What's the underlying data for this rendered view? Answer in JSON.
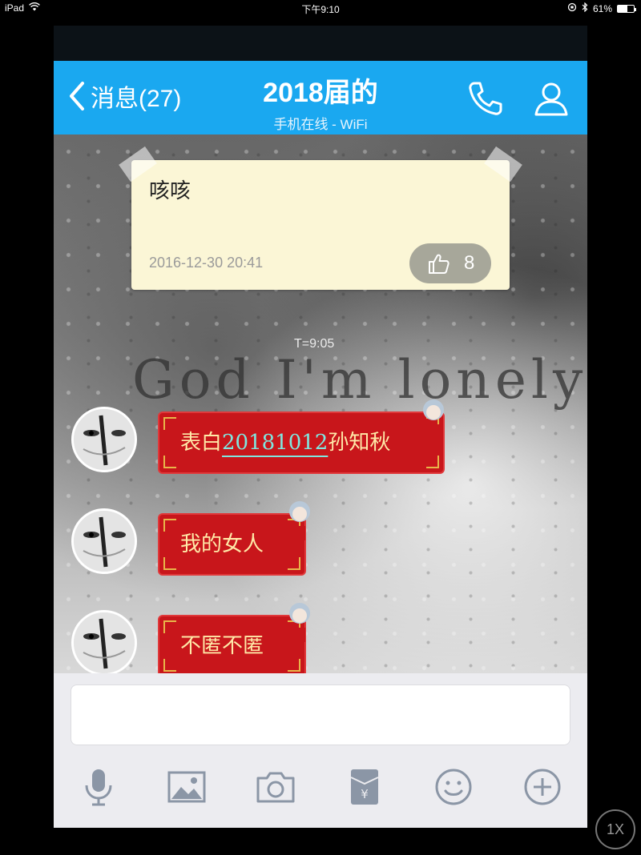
{
  "status_bar": {
    "device": "iPad",
    "time": "下午9:10",
    "battery": "61%",
    "battery_level": 0.61
  },
  "nav": {
    "back_label": "消息(27)",
    "title": "2018届的",
    "subtitle": "手机在线 - WiFi"
  },
  "pinned_note": {
    "text": "咳咳",
    "date": "2016-12-30 20:41",
    "likes": "8"
  },
  "background": {
    "overlay_text": "God I'm lonely",
    "time_mark": "T=9:05"
  },
  "messages": [
    {
      "prefix": "表白",
      "highlight": "20181012",
      "suffix": "孙知秋"
    },
    {
      "text": "我的女人"
    },
    {
      "text": "不匿不匿"
    }
  ],
  "input": {
    "placeholder": ""
  },
  "toolbar": [
    "microphone-icon",
    "image-icon",
    "camera-icon",
    "red-packet-icon",
    "emoji-icon",
    "plus-icon"
  ],
  "zoom_button": "1X",
  "colors": {
    "nav": "#1aa8f0",
    "bubble": "#c8161b",
    "bubble_text": "#ffe9a8",
    "highlight": "#7fe7e0",
    "note": "#fbf6d6"
  }
}
